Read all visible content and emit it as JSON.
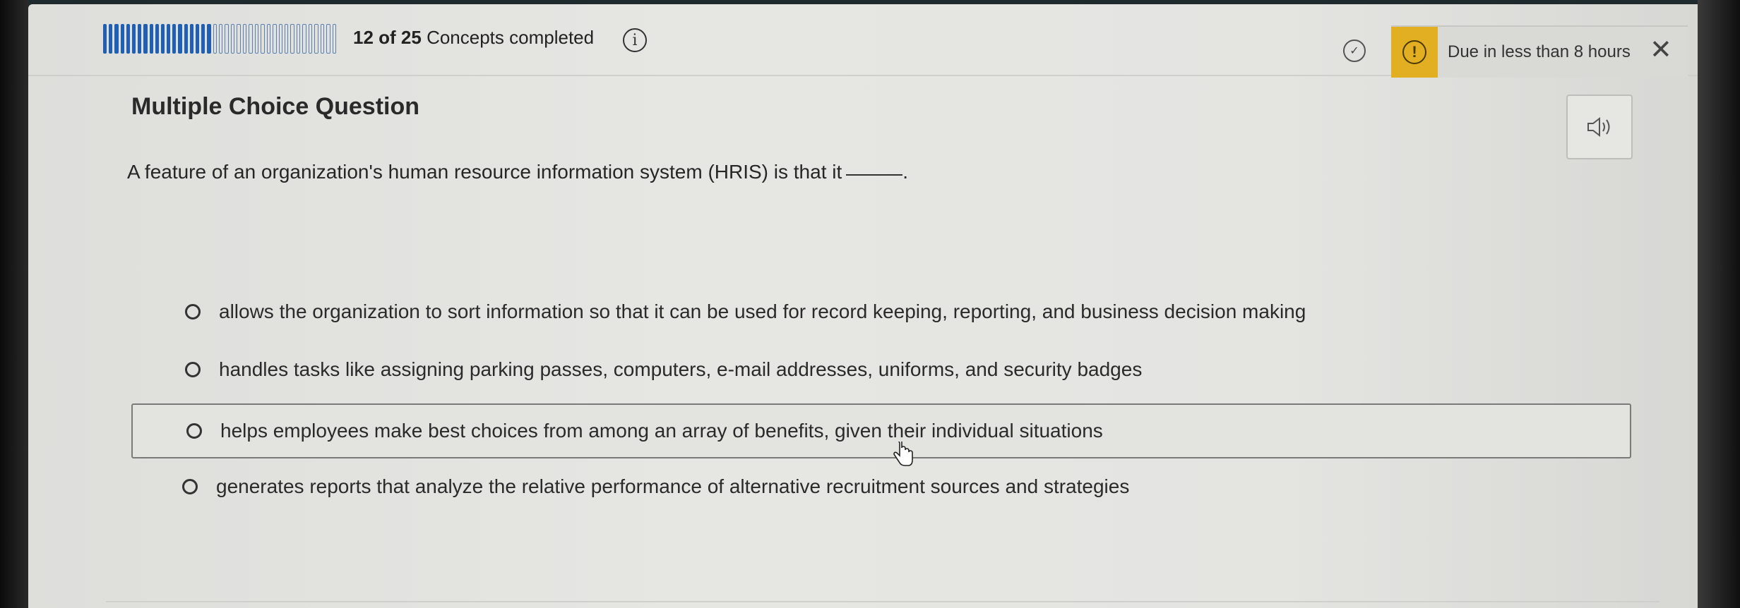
{
  "header": {
    "progress": {
      "completed": 12,
      "total": 25,
      "count_text": "12 of 25",
      "label": "Concepts completed"
    },
    "info_icon": "info-icon",
    "check_icon": "check-circle-icon",
    "due": {
      "warning_icon": "warning-icon",
      "text": "Due in less than 8 hours",
      "close_icon": "close-icon"
    }
  },
  "question": {
    "type_label": "Multiple Choice Question",
    "prompt": "A feature of an organization's human resource information system (HRIS) is that it",
    "blank_suffix": ".",
    "audio_icon": "speaker-icon"
  },
  "options": [
    {
      "text": "allows the organization to sort information so that it can be used for record keeping, reporting, and business decision making"
    },
    {
      "text": "handles tasks like assigning parking passes, computers, e-mail addresses, uniforms, and security badges"
    },
    {
      "text": "helps employees make best choices from among an array of benefits, given their individual situations",
      "hovered": true
    },
    {
      "text": "generates reports that analyze the relative performance of alternative recruitment sources and strategies"
    }
  ],
  "colors": {
    "progress_done": "#1f5fb4",
    "warning": "#e2ae22"
  }
}
